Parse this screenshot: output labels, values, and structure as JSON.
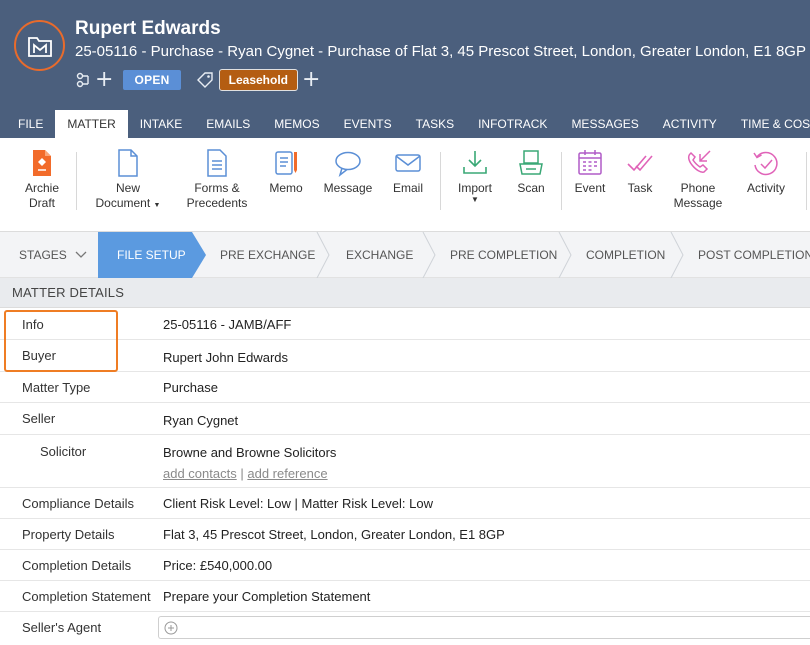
{
  "header": {
    "title": "Rupert Edwards",
    "subtitle": "25-05116 - Purchase - Ryan Cygnet - Purchase of Flat 3, 45 Prescot Street, London, Greater London, E1 8GP",
    "status": "OPEN",
    "tag": "Leasehold",
    "plus_symbol": "+"
  },
  "tabs": [
    "FILE",
    "MATTER",
    "INTAKE",
    "EMAILS",
    "MEMOS",
    "EVENTS",
    "TASKS",
    "INFOTRACK",
    "MESSAGES",
    "ACTIVITY",
    "TIME & COST R"
  ],
  "ribbon": {
    "archie": [
      "Archie",
      "Draft"
    ],
    "new_document": [
      "New",
      "Document"
    ],
    "forms": [
      "Forms &",
      "Precedents"
    ],
    "memo": "Memo",
    "message": "Message",
    "email": "Email",
    "import": "Import",
    "scan": "Scan",
    "event": "Event",
    "task": "Task",
    "phone": [
      "Phone",
      "Message"
    ],
    "activity": "Activity",
    "caret": "▼"
  },
  "stages": {
    "label": "STAGES",
    "items": [
      "FILE SETUP",
      "PRE EXCHANGE",
      "EXCHANGE",
      "PRE COMPLETION",
      "COMPLETION",
      "POST COMPLETION"
    ]
  },
  "details": {
    "heading": "MATTER DETAILS",
    "rows": [
      {
        "label": "Info",
        "value": "25-05116 - JAMB/AFF"
      },
      {
        "label": "Buyer",
        "value": "Rupert John Edwards"
      },
      {
        "label": "Matter Type",
        "value": "Purchase"
      },
      {
        "label": "Seller",
        "value": "Ryan Cygnet"
      },
      {
        "label": "Solicitor",
        "value": "Browne and Browne Solicitors"
      },
      {
        "label": "Compliance Details",
        "value": "Client Risk Level: Low | Matter Risk Level: Low"
      },
      {
        "label": "Property Details",
        "value": "Flat 3, 45 Prescot Street, London, Greater London, E1 8GP"
      },
      {
        "label": "Completion Details",
        "value": "Price: £540,000.00"
      },
      {
        "label": "Completion Statement",
        "value": "Prepare your Completion Statement"
      },
      {
        "label": "Seller's Agent",
        "value": ""
      }
    ],
    "add_contacts": "add contacts",
    "add_reference": "add reference",
    "link_separator": "|"
  },
  "colors": {
    "header_bg": "#4b5f7d",
    "accent_orange": "#e86b2c",
    "status_blue": "#5b8fd6",
    "tag_brown": "#b45d12",
    "stage_active": "#5b9ae0"
  }
}
